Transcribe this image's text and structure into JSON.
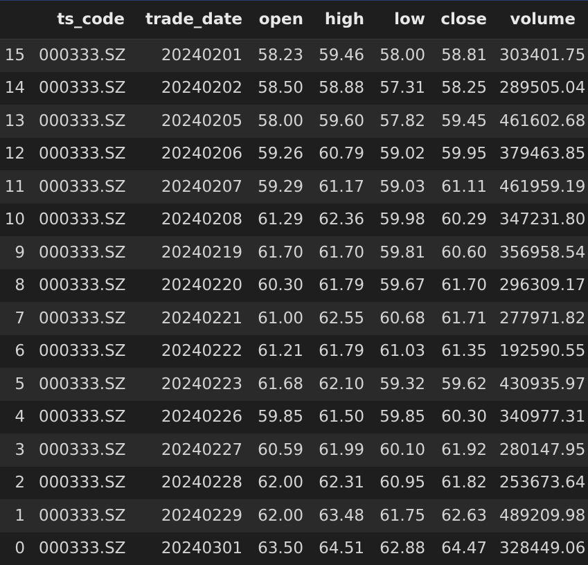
{
  "table": {
    "columns": [
      "",
      "ts_code",
      "trade_date",
      "open",
      "high",
      "low",
      "close",
      "volume"
    ],
    "rows": [
      {
        "index": "15",
        "ts_code": "000333.SZ",
        "trade_date": "20240201",
        "open": "58.23",
        "high": "59.46",
        "low": "58.00",
        "close": "58.81",
        "volume": "303401.75"
      },
      {
        "index": "14",
        "ts_code": "000333.SZ",
        "trade_date": "20240202",
        "open": "58.50",
        "high": "58.88",
        "low": "57.31",
        "close": "58.25",
        "volume": "289505.04"
      },
      {
        "index": "13",
        "ts_code": "000333.SZ",
        "trade_date": "20240205",
        "open": "58.00",
        "high": "59.60",
        "low": "57.82",
        "close": "59.45",
        "volume": "461602.68"
      },
      {
        "index": "12",
        "ts_code": "000333.SZ",
        "trade_date": "20240206",
        "open": "59.26",
        "high": "60.79",
        "low": "59.02",
        "close": "59.95",
        "volume": "379463.85"
      },
      {
        "index": "11",
        "ts_code": "000333.SZ",
        "trade_date": "20240207",
        "open": "59.29",
        "high": "61.17",
        "low": "59.03",
        "close": "61.11",
        "volume": "461959.19"
      },
      {
        "index": "10",
        "ts_code": "000333.SZ",
        "trade_date": "20240208",
        "open": "61.29",
        "high": "62.36",
        "low": "59.98",
        "close": "60.29",
        "volume": "347231.80"
      },
      {
        "index": "9",
        "ts_code": "000333.SZ",
        "trade_date": "20240219",
        "open": "61.70",
        "high": "61.70",
        "low": "59.81",
        "close": "60.60",
        "volume": "356958.54"
      },
      {
        "index": "8",
        "ts_code": "000333.SZ",
        "trade_date": "20240220",
        "open": "60.30",
        "high": "61.79",
        "low": "59.67",
        "close": "61.70",
        "volume": "296309.17"
      },
      {
        "index": "7",
        "ts_code": "000333.SZ",
        "trade_date": "20240221",
        "open": "61.00",
        "high": "62.55",
        "low": "60.68",
        "close": "61.71",
        "volume": "277971.82"
      },
      {
        "index": "6",
        "ts_code": "000333.SZ",
        "trade_date": "20240222",
        "open": "61.21",
        "high": "61.79",
        "low": "61.03",
        "close": "61.35",
        "volume": "192590.55"
      },
      {
        "index": "5",
        "ts_code": "000333.SZ",
        "trade_date": "20240223",
        "open": "61.68",
        "high": "62.10",
        "low": "59.32",
        "close": "59.62",
        "volume": "430935.97"
      },
      {
        "index": "4",
        "ts_code": "000333.SZ",
        "trade_date": "20240226",
        "open": "59.85",
        "high": "61.50",
        "low": "59.85",
        "close": "60.30",
        "volume": "340977.31"
      },
      {
        "index": "3",
        "ts_code": "000333.SZ",
        "trade_date": "20240227",
        "open": "60.59",
        "high": "61.99",
        "low": "60.10",
        "close": "61.92",
        "volume": "280147.95"
      },
      {
        "index": "2",
        "ts_code": "000333.SZ",
        "trade_date": "20240228",
        "open": "62.00",
        "high": "62.31",
        "low": "60.95",
        "close": "61.82",
        "volume": "253673.64"
      },
      {
        "index": "1",
        "ts_code": "000333.SZ",
        "trade_date": "20240229",
        "open": "62.00",
        "high": "63.48",
        "low": "61.75",
        "close": "62.63",
        "volume": "489209.98"
      },
      {
        "index": "0",
        "ts_code": "000333.SZ",
        "trade_date": "20240301",
        "open": "63.50",
        "high": "64.51",
        "low": "62.88",
        "close": "64.47",
        "volume": "328449.06"
      }
    ]
  }
}
